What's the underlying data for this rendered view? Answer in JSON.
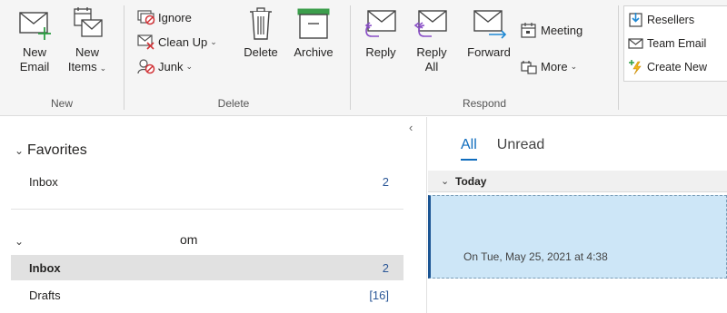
{
  "ribbon": {
    "new_group": {
      "label": "New",
      "new_email": {
        "line1": "New",
        "line2": "Email"
      },
      "new_items": {
        "line1": "New",
        "line2": "Items",
        "caret": "⌄"
      }
    },
    "delete_group": {
      "label": "Delete",
      "ignore": "Ignore",
      "clean_up": "Clean Up",
      "junk": "Junk",
      "delete": "Delete",
      "archive": "Archive",
      "caret": "⌄"
    },
    "respond_group": {
      "label": "Respond",
      "reply": "Reply",
      "reply_all": {
        "line1": "Reply",
        "line2": "All"
      },
      "forward": "Forward",
      "meeting": "Meeting",
      "more": "More",
      "caret": "⌄"
    },
    "quick_steps": {
      "items": [
        "Resellers",
        "Team Email",
        "Create New"
      ]
    }
  },
  "folder_pane": {
    "collapse_arrow": "‹",
    "favorites": {
      "chevron": "⌄",
      "title": "Favorites",
      "items": [
        {
          "name": "Inbox",
          "count": "2"
        }
      ]
    },
    "account": {
      "chevron": "⌄",
      "name_fragment": "om",
      "folders": [
        {
          "name": "Inbox",
          "count": "2"
        },
        {
          "name": "Drafts",
          "count": "[16]"
        }
      ]
    }
  },
  "message_list": {
    "tabs": [
      {
        "label": "All"
      },
      {
        "label": "Unread"
      }
    ],
    "group_header": {
      "chevron": "⌄",
      "label": "Today"
    },
    "selected_message": {
      "date": "On Tue, May 25, 2021 at 4:38"
    }
  },
  "colors": {
    "accent": "#0f6cbd",
    "selected_message_bg": "#cde6f7",
    "selected_folder_bg": "#e1e1e1",
    "count": "#2b5797"
  }
}
